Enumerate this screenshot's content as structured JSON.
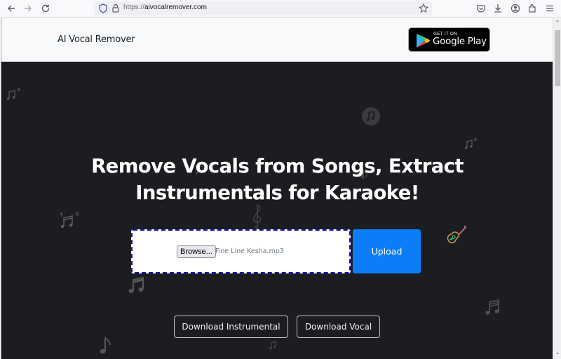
{
  "browser": {
    "url_scheme": "https://",
    "url_host": "aivocalremover.com",
    "icons": [
      "back-icon",
      "forward-icon",
      "reload-icon",
      "shield-icon",
      "lock-icon",
      "bookmark-star-icon",
      "pocket-icon",
      "download-icon",
      "account-icon",
      "extensions-icon",
      "menu-icon"
    ]
  },
  "header": {
    "brand": "AI Vocal Remover",
    "google_play": {
      "small": "GET IT ON",
      "big": "Google Play"
    }
  },
  "hero": {
    "title_line1": "Remove Vocals from Songs, Extract",
    "title_line2": "Instrumentals for Karaoke!",
    "upload": {
      "browse_label": "Browse...",
      "file_name": "Fine Line Kesha.mp3",
      "upload_label": "Upload"
    },
    "download_instrumental": "Download Instrumental",
    "download_vocal": "Download Vocal"
  },
  "colors": {
    "hero_bg": "#1c1d20",
    "header_bg": "#f8f9fa",
    "upload_blue": "#0d7cf7",
    "dropzone_border": "#1a10b8"
  }
}
